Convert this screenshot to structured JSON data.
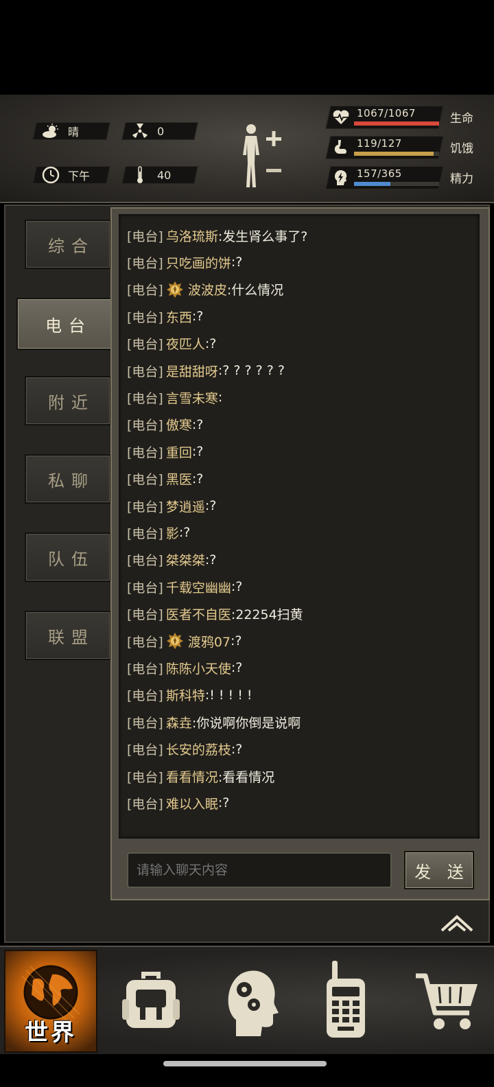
{
  "status": {
    "weather": "晴",
    "radiation": "0",
    "time_of_day": "下午",
    "temperature": "40"
  },
  "vitals": [
    {
      "key": "health",
      "value": "1067/1067",
      "label": "生命",
      "fraction": 1.0,
      "color": "#d9493b",
      "icon": "heart-pulse-icon"
    },
    {
      "key": "hunger",
      "value": "119/127",
      "label": "饥饿",
      "fraction": 0.937,
      "color": "#c7a04a",
      "icon": "stomach-icon"
    },
    {
      "key": "energy",
      "value": "157/365",
      "label": "精力",
      "fraction": 0.43,
      "color": "#4f8bd0",
      "icon": "head-lightning-icon"
    }
  ],
  "tabs": [
    {
      "label": "综合",
      "active": false
    },
    {
      "label": "电台",
      "active": true
    },
    {
      "label": "附近",
      "active": false
    },
    {
      "label": "私聊",
      "active": false
    },
    {
      "label": "队伍",
      "active": false
    },
    {
      "label": "联盟",
      "active": false
    }
  ],
  "chat": {
    "channel_tag": "[电台]",
    "messages": [
      {
        "name": "乌洛琉斯",
        "text": ":发生肾么事了?",
        "badge": false
      },
      {
        "name": "只吃画的饼",
        "text": ":?",
        "badge": false
      },
      {
        "name": "波波皮",
        "text": ":什么情况",
        "badge": true
      },
      {
        "name": "东西",
        "text": ":?",
        "badge": false
      },
      {
        "name": "夜匹人",
        "text": ":?",
        "badge": false
      },
      {
        "name": "是甜甜呀",
        "text": ":? ? ? ? ? ?",
        "badge": false
      },
      {
        "name": "言雪未寒",
        "text": ":",
        "badge": false
      },
      {
        "name": "傲寒",
        "text": ":?",
        "badge": false
      },
      {
        "name": "重回",
        "text": ":?",
        "badge": false
      },
      {
        "name": "黑医",
        "text": ":?",
        "badge": false
      },
      {
        "name": "梦逍遥",
        "text": ":?",
        "badge": false
      },
      {
        "name": "影",
        "text": ":?",
        "badge": false
      },
      {
        "name": "桀桀桀",
        "text": ":?",
        "badge": false
      },
      {
        "name": "千载空幽幽",
        "text": ":?",
        "badge": false
      },
      {
        "name": "医者不自医",
        "text": ":22254扫黄",
        "badge": false
      },
      {
        "name": "渡鸦07",
        "text": ":?",
        "badge": true
      },
      {
        "name": "陈陈小天使",
        "text": ":?",
        "badge": false
      },
      {
        "name": "斯科特",
        "text": ":! ! ! ! !",
        "badge": false
      },
      {
        "name": "森垚",
        "text": ":你说啊你倒是说啊",
        "badge": false
      },
      {
        "name": "长安的荔枝",
        "text": ":?",
        "badge": false
      },
      {
        "name": "看看情况",
        "text": ":看看情况",
        "badge": false
      },
      {
        "name": "难以入眠",
        "text": ":?",
        "badge": false
      }
    ],
    "input_placeholder": "请输入聊天内容",
    "send_label": "发 送"
  },
  "bottom_nav": {
    "world_label": "世界",
    "items": [
      "globe-icon",
      "backpack-icon",
      "brain-gear-icon",
      "walkie-talkie-icon",
      "shopping-cart-icon"
    ]
  }
}
